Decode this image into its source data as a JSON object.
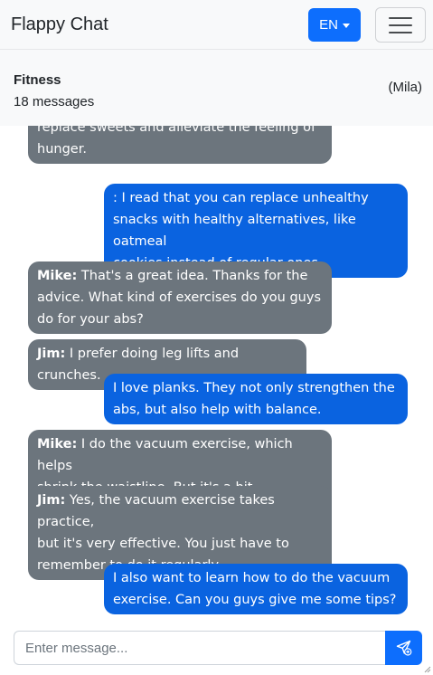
{
  "navbar": {
    "brand": "Flappy Chat",
    "language_label": "EN"
  },
  "chat": {
    "title": "Fitness",
    "message_count": "18 messages",
    "current_user": "(Mila)"
  },
  "messages": [
    {
      "side": "other",
      "sender": "",
      "text": "replace sweets and alleviate the feeling of\nhunger."
    },
    {
      "side": "mine",
      "sender": "",
      "text": ": I read that you can replace unhealthy\nsnacks with healthy alternatives, like oatmeal\ncookies instead of regular ones."
    },
    {
      "side": "other",
      "sender": "Mike:",
      "text": " That's a great idea. Thanks for the\nadvice. What kind of exercises do you guys\ndo for your abs?"
    },
    {
      "side": "other",
      "sender": "Jim:",
      "text": " I prefer doing leg lifts and crunches."
    },
    {
      "side": "mine",
      "sender": "",
      "text": "I love planks. They not only strengthen the\nabs, but also help with balance."
    },
    {
      "side": "other",
      "sender": "Mike:",
      "text": " I do the vacuum exercise, which helps\nshrink the waistline. But it's a bit challenging."
    },
    {
      "side": "other",
      "sender": "Jim:",
      "text": " Yes, the vacuum exercise takes practice,\nbut it's very effective. You just have to\nremember to do it regularly."
    },
    {
      "side": "mine",
      "sender": "",
      "text": "I also want to learn how to do the vacuum\nexercise. Can you guys give me some tips?"
    }
  ],
  "composer": {
    "placeholder": "Enter message...",
    "send_icon": "send-plus-icon"
  },
  "colors": {
    "primary": "#0d6efd",
    "mine_bubble": "#0a63e0",
    "other_bubble": "#6c757d",
    "header_bg": "#f8f9fa"
  }
}
